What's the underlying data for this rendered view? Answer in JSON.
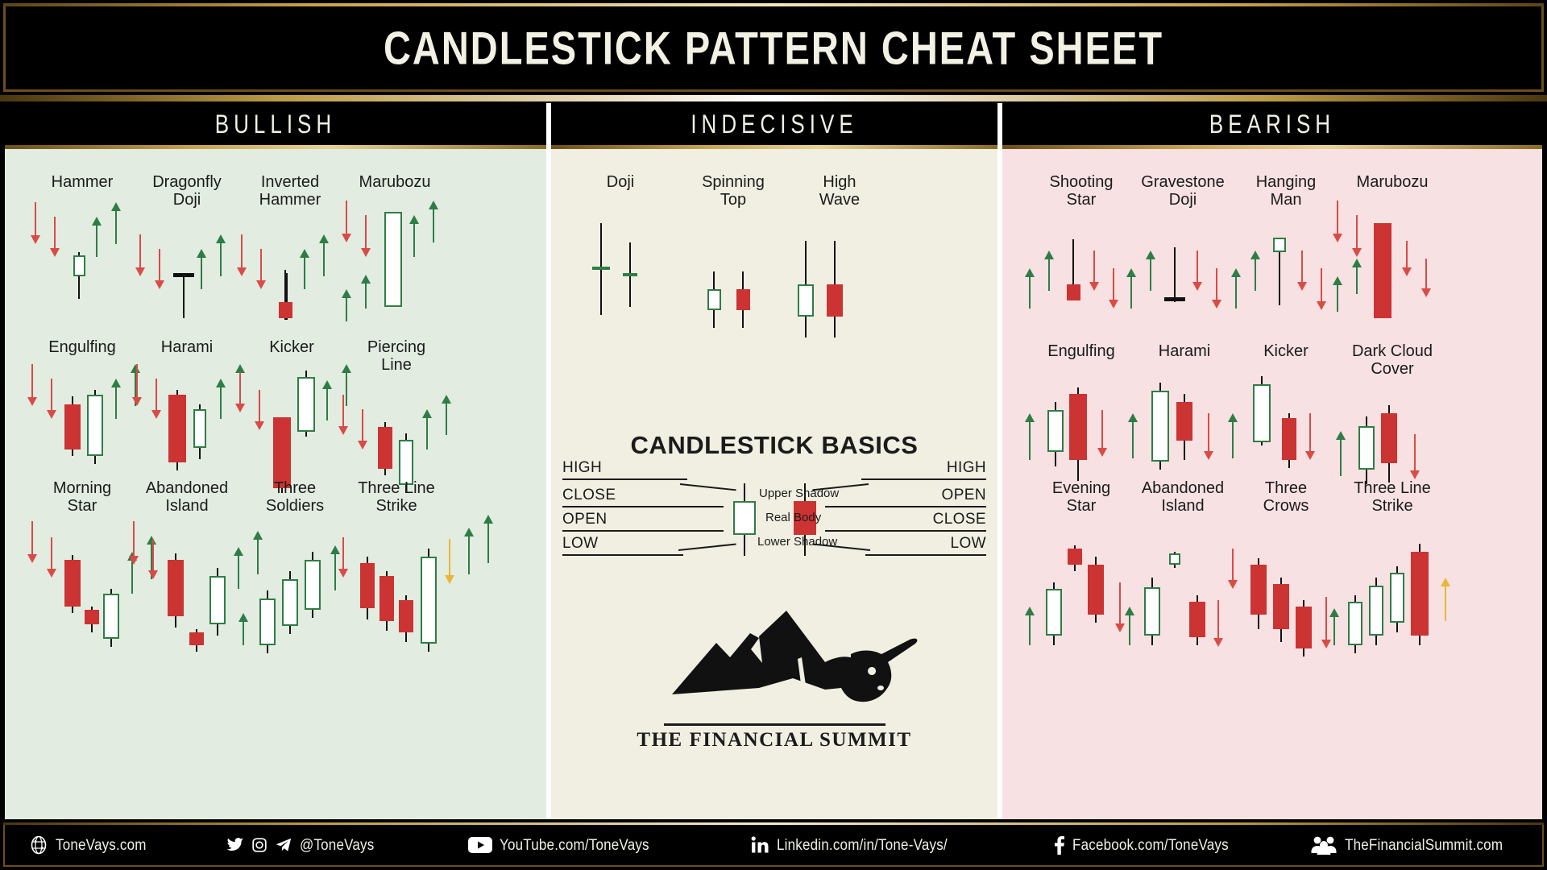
{
  "header": {
    "title": "CANDLESTICK PATTERN CHEAT SHEET"
  },
  "columns": [
    {
      "id": "bullish",
      "label": "BULLISH"
    },
    {
      "id": "indecisive",
      "label": "INDECISIVE"
    },
    {
      "id": "bearish",
      "label": "BEARISH"
    }
  ],
  "colors": {
    "bullish_bg": "#e2ece1",
    "indecisive_bg": "#f0efe2",
    "bearish_bg": "#f7e1e2",
    "up_candle": "#ffffff",
    "up_border": "#2f7d46",
    "down_candle": "#cc3333",
    "up_arrow": "#2f7d46",
    "down_arrow": "#d94b46",
    "neutral_arrow": "#e8b63a",
    "gold_trim": "#c7a44d",
    "cream_text": "#f2f1e4"
  },
  "bullish": {
    "patterns": [
      {
        "name": "Hammer"
      },
      {
        "name": "Dragonfly\nDoji"
      },
      {
        "name": "Inverted\nHammer"
      },
      {
        "name": "Marubozu"
      },
      {
        "name": "Engulfing"
      },
      {
        "name": "Harami"
      },
      {
        "name": "Kicker"
      },
      {
        "name": "Piercing\nLine"
      },
      {
        "name": "Morning\nStar"
      },
      {
        "name": "Abandoned\nIsland"
      },
      {
        "name": "Three\nSoldiers"
      },
      {
        "name": "Three Line\nStrike"
      }
    ]
  },
  "indecisive": {
    "patterns": [
      {
        "name": "Doji"
      },
      {
        "name": "Spinning\nTop"
      },
      {
        "name": "High\nWave"
      }
    ],
    "basics": {
      "title": "CANDLESTICK BASICS",
      "left_labels": [
        "HIGH",
        "CLOSE",
        "OPEN",
        "LOW"
      ],
      "right_labels": [
        "HIGH",
        "OPEN",
        "CLOSE",
        "LOW"
      ],
      "parts": [
        "Upper Shadow",
        "Real Body",
        "Lower Shadow"
      ]
    },
    "logo": {
      "text": "THE FINANCIAL SUMMIT",
      "icon": "bull-mountain-logo"
    }
  },
  "bearish": {
    "patterns": [
      {
        "name": "Shooting\nStar"
      },
      {
        "name": "Gravestone\nDoji"
      },
      {
        "name": "Hanging\nMan"
      },
      {
        "name": "Marubozu"
      },
      {
        "name": "Engulfing"
      },
      {
        "name": "Harami"
      },
      {
        "name": "Kicker"
      },
      {
        "name": "Dark Cloud\nCover"
      },
      {
        "name": "Evening\nStar"
      },
      {
        "name": "Abandoned\nIsland"
      },
      {
        "name": "Three\nCrows"
      },
      {
        "name": "Three Line\nStrike"
      }
    ]
  },
  "footer": {
    "items": [
      {
        "icon": "globe-icon",
        "text": "ToneVays.com"
      },
      {
        "icon": "twitter-instagram-telegram-icons",
        "text": "@ToneVays"
      },
      {
        "icon": "youtube-icon",
        "text": "YouTube.com/ToneVays"
      },
      {
        "icon": "linkedin-icon",
        "text": "Linkedin.com/in/Tone-Vays/"
      },
      {
        "icon": "facebook-icon",
        "text": "Facebook.com/ToneVays"
      },
      {
        "icon": "people-icon",
        "text": "TheFinancialSummit.com"
      }
    ]
  }
}
